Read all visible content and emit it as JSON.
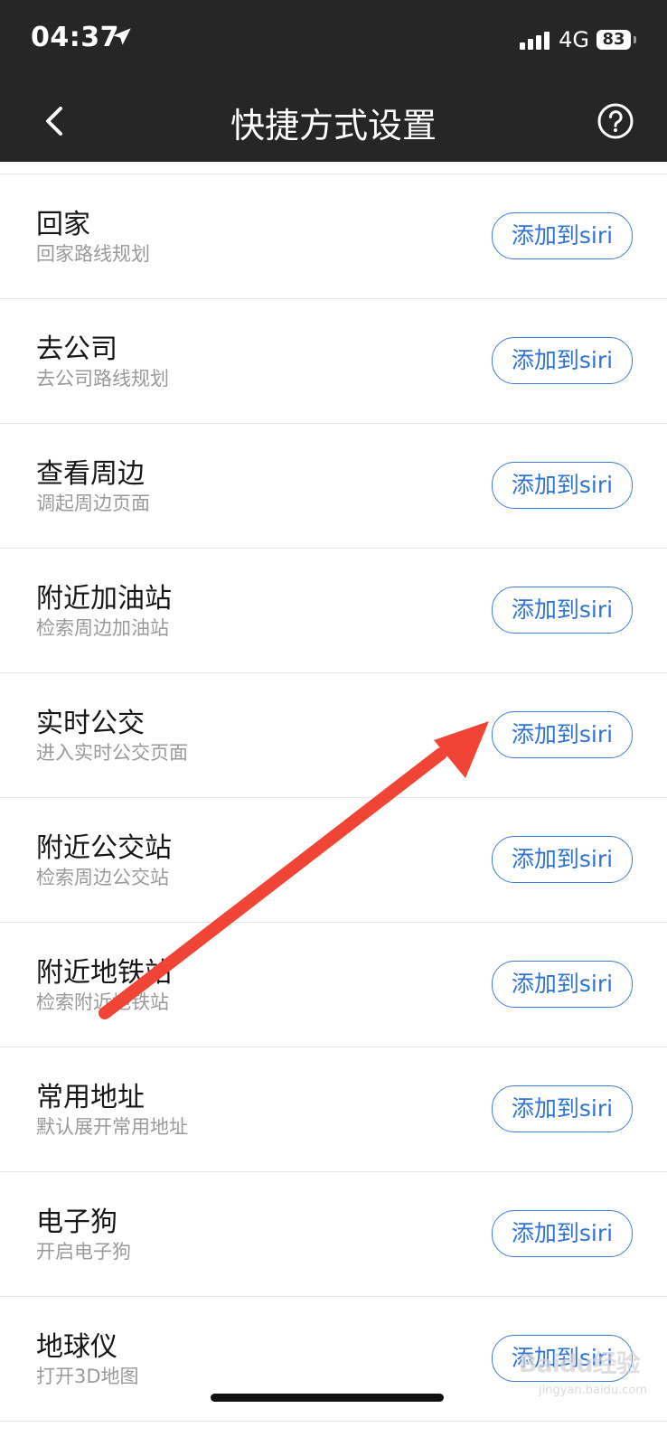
{
  "status_bar": {
    "time": "04:37",
    "network": "4G",
    "battery": "83",
    "icons": [
      "location-arrow-icon",
      "signal-bars-icon",
      "battery-icon"
    ]
  },
  "header": {
    "title": "快捷方式设置",
    "back_icon": "chevron-left-icon",
    "help_icon": "question-circle-icon"
  },
  "shortcuts": [
    {
      "title": "回家",
      "subtitle": "回家路线规划",
      "button": "添加到siri"
    },
    {
      "title": "去公司",
      "subtitle": "去公司路线规划",
      "button": "添加到siri"
    },
    {
      "title": "查看周边",
      "subtitle": "调起周边页面",
      "button": "添加到siri"
    },
    {
      "title": "附近加油站",
      "subtitle": "检索周边加油站",
      "button": "添加到siri"
    },
    {
      "title": "实时公交",
      "subtitle": "进入实时公交页面",
      "button": "添加到siri"
    },
    {
      "title": "附近公交站",
      "subtitle": "检索周边公交站",
      "button": "添加到siri"
    },
    {
      "title": "附近地铁站",
      "subtitle": "检索附近地铁站",
      "button": "添加到siri"
    },
    {
      "title": "常用地址",
      "subtitle": "默认展开常用地址",
      "button": "添加到siri"
    },
    {
      "title": "电子狗",
      "subtitle": "开启电子狗",
      "button": "添加到siri"
    },
    {
      "title": "地球仪",
      "subtitle": "打开3D地图",
      "button": "添加到siri"
    }
  ],
  "watermark": {
    "main": "Baidu经验",
    "sub": "jingyan.baidu.com"
  },
  "colors": {
    "header_bg": "#262626",
    "button_blue": "#2f73d8",
    "annotation_red": "#f04536"
  }
}
